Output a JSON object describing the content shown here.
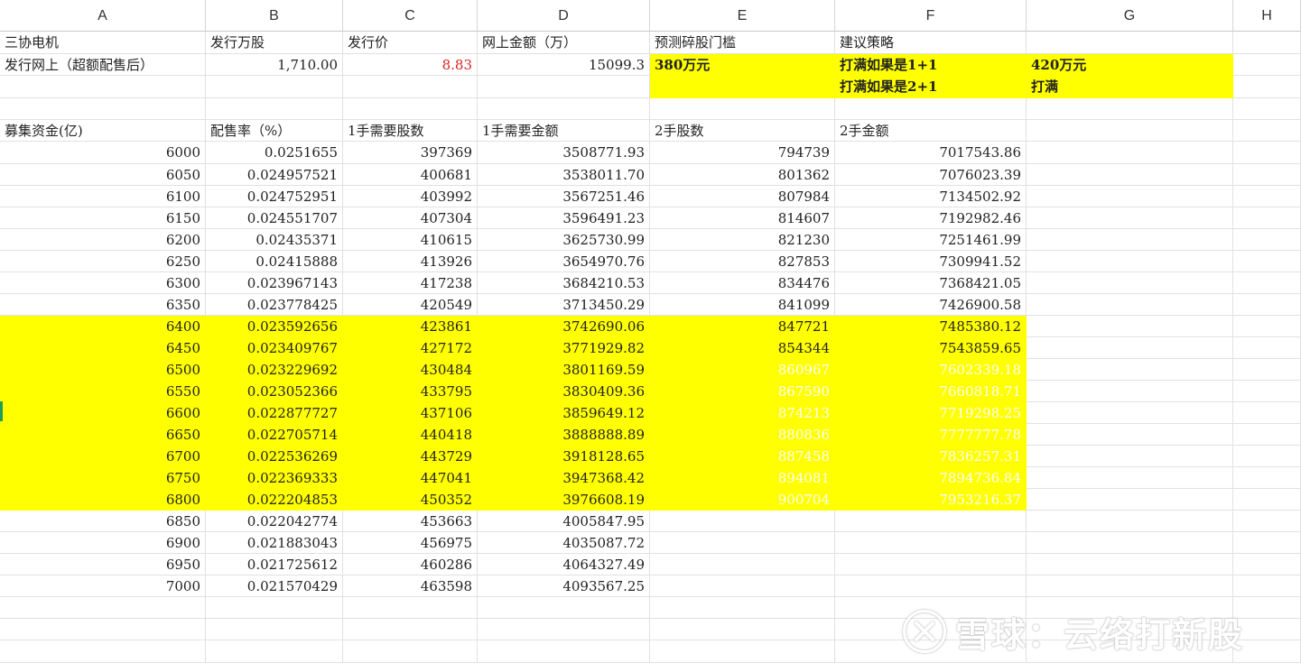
{
  "columns": [
    "A",
    "B",
    "C",
    "D",
    "E",
    "F",
    "G",
    "H"
  ],
  "rows": [
    {
      "cells": [
        {
          "t": "三协电机",
          "al": "l"
        },
        {
          "t": "发行万股",
          "al": "l"
        },
        {
          "t": "发行价",
          "al": "l"
        },
        {
          "t": "网上金额（万）",
          "al": "l"
        },
        {
          "t": "预测碎股门槛",
          "al": "l"
        },
        {
          "t": "建议策略",
          "al": "l"
        },
        {
          "t": ""
        },
        {
          "t": ""
        }
      ]
    },
    {
      "cells": [
        {
          "t": "发行网上（超额配售后）",
          "al": "l"
        },
        {
          "t": "1,710.00",
          "al": "r"
        },
        {
          "t": "8.83",
          "al": "r",
          "red": true
        },
        {
          "t": "15099.3",
          "al": "r"
        },
        {
          "t": "380万元",
          "al": "l",
          "y": true,
          "b": true
        },
        {
          "t": "打满如果是1+1",
          "al": "l",
          "y": true,
          "b": true
        },
        {
          "t": "420万元",
          "al": "l",
          "y": true,
          "b": true
        },
        {
          "t": ""
        }
      ]
    },
    {
      "cells": [
        {
          "t": ""
        },
        {
          "t": ""
        },
        {
          "t": ""
        },
        {
          "t": ""
        },
        {
          "t": "",
          "y": true
        },
        {
          "t": "打满如果是2+1",
          "al": "l",
          "y": true,
          "b": true
        },
        {
          "t": "打满",
          "al": "l",
          "y": true,
          "b": true
        },
        {
          "t": ""
        }
      ]
    },
    {
      "cells": [
        {
          "t": ""
        },
        {
          "t": ""
        },
        {
          "t": ""
        },
        {
          "t": ""
        },
        {
          "t": ""
        },
        {
          "t": ""
        },
        {
          "t": ""
        },
        {
          "t": ""
        }
      ]
    },
    {
      "cells": [
        {
          "t": "募集资金(亿)",
          "al": "l"
        },
        {
          "t": "配售率（%）",
          "al": "l"
        },
        {
          "t": "1手需要股数",
          "al": "l"
        },
        {
          "t": "1手需要金额",
          "al": "l"
        },
        {
          "t": "2手股数",
          "al": "l"
        },
        {
          "t": "2手金额",
          "al": "l"
        },
        {
          "t": ""
        },
        {
          "t": ""
        }
      ]
    },
    {
      "cells": [
        {
          "t": "6000",
          "al": "r"
        },
        {
          "t": "0.0251655",
          "al": "r"
        },
        {
          "t": "397369",
          "al": "r"
        },
        {
          "t": "3508771.93",
          "al": "r"
        },
        {
          "t": "794739",
          "al": "r"
        },
        {
          "t": "7017543.86",
          "al": "r"
        },
        {
          "t": ""
        },
        {
          "t": ""
        }
      ]
    },
    {
      "cells": [
        {
          "t": "6050",
          "al": "r"
        },
        {
          "t": "0.024957521",
          "al": "r"
        },
        {
          "t": "400681",
          "al": "r"
        },
        {
          "t": "3538011.70",
          "al": "r"
        },
        {
          "t": "801362",
          "al": "r"
        },
        {
          "t": "7076023.39",
          "al": "r"
        },
        {
          "t": ""
        },
        {
          "t": ""
        }
      ]
    },
    {
      "cells": [
        {
          "t": "6100",
          "al": "r"
        },
        {
          "t": "0.024752951",
          "al": "r"
        },
        {
          "t": "403992",
          "al": "r"
        },
        {
          "t": "3567251.46",
          "al": "r"
        },
        {
          "t": "807984",
          "al": "r"
        },
        {
          "t": "7134502.92",
          "al": "r"
        },
        {
          "t": ""
        },
        {
          "t": ""
        }
      ]
    },
    {
      "cells": [
        {
          "t": "6150",
          "al": "r"
        },
        {
          "t": "0.024551707",
          "al": "r"
        },
        {
          "t": "407304",
          "al": "r"
        },
        {
          "t": "3596491.23",
          "al": "r"
        },
        {
          "t": "814607",
          "al": "r"
        },
        {
          "t": "7192982.46",
          "al": "r"
        },
        {
          "t": ""
        },
        {
          "t": ""
        }
      ]
    },
    {
      "cells": [
        {
          "t": "6200",
          "al": "r"
        },
        {
          "t": "0.02435371",
          "al": "r"
        },
        {
          "t": "410615",
          "al": "r"
        },
        {
          "t": "3625730.99",
          "al": "r"
        },
        {
          "t": "821230",
          "al": "r"
        },
        {
          "t": "7251461.99",
          "al": "r"
        },
        {
          "t": ""
        },
        {
          "t": ""
        }
      ]
    },
    {
      "cells": [
        {
          "t": "6250",
          "al": "r"
        },
        {
          "t": "0.02415888",
          "al": "r"
        },
        {
          "t": "413926",
          "al": "r"
        },
        {
          "t": "3654970.76",
          "al": "r"
        },
        {
          "t": "827853",
          "al": "r"
        },
        {
          "t": "7309941.52",
          "al": "r"
        },
        {
          "t": ""
        },
        {
          "t": ""
        }
      ]
    },
    {
      "cells": [
        {
          "t": "6300",
          "al": "r"
        },
        {
          "t": "0.023967143",
          "al": "r"
        },
        {
          "t": "417238",
          "al": "r"
        },
        {
          "t": "3684210.53",
          "al": "r"
        },
        {
          "t": "834476",
          "al": "r"
        },
        {
          "t": "7368421.05",
          "al": "r"
        },
        {
          "t": ""
        },
        {
          "t": ""
        }
      ]
    },
    {
      "cells": [
        {
          "t": "6350",
          "al": "r"
        },
        {
          "t": "0.023778425",
          "al": "r"
        },
        {
          "t": "420549",
          "al": "r"
        },
        {
          "t": "3713450.29",
          "al": "r"
        },
        {
          "t": "841099",
          "al": "r"
        },
        {
          "t": "7426900.58",
          "al": "r"
        },
        {
          "t": ""
        },
        {
          "t": ""
        }
      ]
    },
    {
      "cells": [
        {
          "t": "6400",
          "al": "r",
          "y": true
        },
        {
          "t": "0.023592656",
          "al": "r",
          "y": true
        },
        {
          "t": "423861",
          "al": "r",
          "y": true
        },
        {
          "t": "3742690.06",
          "al": "r",
          "y": true
        },
        {
          "t": "847721",
          "al": "r",
          "y": true
        },
        {
          "t": "7485380.12",
          "al": "r",
          "y": true
        },
        {
          "t": ""
        },
        {
          "t": ""
        }
      ]
    },
    {
      "cells": [
        {
          "t": "6450",
          "al": "r",
          "y": true
        },
        {
          "t": "0.023409767",
          "al": "r",
          "y": true
        },
        {
          "t": "427172",
          "al": "r",
          "y": true
        },
        {
          "t": "3771929.82",
          "al": "r",
          "y": true
        },
        {
          "t": "854344",
          "al": "r",
          "y": true
        },
        {
          "t": "7543859.65",
          "al": "r",
          "y": true
        },
        {
          "t": ""
        },
        {
          "t": ""
        }
      ]
    },
    {
      "cells": [
        {
          "t": "6500",
          "al": "r",
          "y": true
        },
        {
          "t": "0.023229692",
          "al": "r",
          "y": true
        },
        {
          "t": "430484",
          "al": "r",
          "y": true
        },
        {
          "t": "3801169.59",
          "al": "r",
          "y": true
        },
        {
          "t": "860967",
          "al": "r",
          "y": true,
          "w": true
        },
        {
          "t": "7602339.18",
          "al": "r",
          "y": true,
          "w": true
        },
        {
          "t": ""
        },
        {
          "t": ""
        }
      ]
    },
    {
      "cells": [
        {
          "t": "6550",
          "al": "r",
          "y": true
        },
        {
          "t": "0.023052366",
          "al": "r",
          "y": true
        },
        {
          "t": "433795",
          "al": "r",
          "y": true
        },
        {
          "t": "3830409.36",
          "al": "r",
          "y": true
        },
        {
          "t": "867590",
          "al": "r",
          "y": true,
          "w": true
        },
        {
          "t": "7660818.71",
          "al": "r",
          "y": true,
          "w": true
        },
        {
          "t": ""
        },
        {
          "t": ""
        }
      ]
    },
    {
      "cells": [
        {
          "t": "6600",
          "al": "r",
          "y": true
        },
        {
          "t": "0.022877727",
          "al": "r",
          "y": true
        },
        {
          "t": "437106",
          "al": "r",
          "y": true
        },
        {
          "t": "3859649.12",
          "al": "r",
          "y": true
        },
        {
          "t": "874213",
          "al": "r",
          "y": true,
          "w": true
        },
        {
          "t": "7719298.25",
          "al": "r",
          "y": true,
          "w": true
        },
        {
          "t": ""
        },
        {
          "t": ""
        }
      ]
    },
    {
      "cells": [
        {
          "t": "6650",
          "al": "r",
          "y": true
        },
        {
          "t": "0.022705714",
          "al": "r",
          "y": true
        },
        {
          "t": "440418",
          "al": "r",
          "y": true
        },
        {
          "t": "3888888.89",
          "al": "r",
          "y": true
        },
        {
          "t": "880836",
          "al": "r",
          "y": true,
          "w": true
        },
        {
          "t": "7777777.78",
          "al": "r",
          "y": true,
          "w": true
        },
        {
          "t": ""
        },
        {
          "t": ""
        }
      ]
    },
    {
      "cells": [
        {
          "t": "6700",
          "al": "r",
          "y": true
        },
        {
          "t": "0.022536269",
          "al": "r",
          "y": true
        },
        {
          "t": "443729",
          "al": "r",
          "y": true
        },
        {
          "t": "3918128.65",
          "al": "r",
          "y": true
        },
        {
          "t": "887458",
          "al": "r",
          "y": true,
          "w": true
        },
        {
          "t": "7836257.31",
          "al": "r",
          "y": true,
          "w": true
        },
        {
          "t": ""
        },
        {
          "t": ""
        }
      ]
    },
    {
      "cells": [
        {
          "t": "6750",
          "al": "r",
          "y": true
        },
        {
          "t": "0.022369333",
          "al": "r",
          "y": true
        },
        {
          "t": "447041",
          "al": "r",
          "y": true
        },
        {
          "t": "3947368.42",
          "al": "r",
          "y": true
        },
        {
          "t": "894081",
          "al": "r",
          "y": true,
          "w": true
        },
        {
          "t": "7894736.84",
          "al": "r",
          "y": true,
          "w": true
        },
        {
          "t": ""
        },
        {
          "t": ""
        }
      ]
    },
    {
      "cells": [
        {
          "t": "6800",
          "al": "r",
          "y": true
        },
        {
          "t": "0.022204853",
          "al": "r",
          "y": true
        },
        {
          "t": "450352",
          "al": "r",
          "y": true
        },
        {
          "t": "3976608.19",
          "al": "r",
          "y": true
        },
        {
          "t": "900704",
          "al": "r",
          "y": true,
          "w": true
        },
        {
          "t": "7953216.37",
          "al": "r",
          "y": true,
          "w": true
        },
        {
          "t": ""
        },
        {
          "t": ""
        }
      ]
    },
    {
      "cells": [
        {
          "t": "6850",
          "al": "r"
        },
        {
          "t": "0.022042774",
          "al": "r"
        },
        {
          "t": "453663",
          "al": "r"
        },
        {
          "t": "4005847.95",
          "al": "r"
        },
        {
          "t": ""
        },
        {
          "t": ""
        },
        {
          "t": ""
        },
        {
          "t": ""
        }
      ]
    },
    {
      "cells": [
        {
          "t": "6900",
          "al": "r"
        },
        {
          "t": "0.021883043",
          "al": "r"
        },
        {
          "t": "456975",
          "al": "r"
        },
        {
          "t": "4035087.72",
          "al": "r"
        },
        {
          "t": ""
        },
        {
          "t": ""
        },
        {
          "t": ""
        },
        {
          "t": ""
        }
      ]
    },
    {
      "cells": [
        {
          "t": "6950",
          "al": "r"
        },
        {
          "t": "0.021725612",
          "al": "r"
        },
        {
          "t": "460286",
          "al": "r"
        },
        {
          "t": "4064327.49",
          "al": "r"
        },
        {
          "t": ""
        },
        {
          "t": ""
        },
        {
          "t": ""
        },
        {
          "t": ""
        }
      ]
    },
    {
      "cells": [
        {
          "t": "7000",
          "al": "r"
        },
        {
          "t": "0.021570429",
          "al": "r"
        },
        {
          "t": "463598",
          "al": "r"
        },
        {
          "t": "4093567.25",
          "al": "r"
        },
        {
          "t": ""
        },
        {
          "t": ""
        },
        {
          "t": ""
        },
        {
          "t": ""
        }
      ]
    },
    {
      "cells": [
        {
          "t": ""
        },
        {
          "t": ""
        },
        {
          "t": ""
        },
        {
          "t": ""
        },
        {
          "t": ""
        },
        {
          "t": ""
        },
        {
          "t": ""
        },
        {
          "t": ""
        }
      ]
    },
    {
      "cells": [
        {
          "t": ""
        },
        {
          "t": ""
        },
        {
          "t": ""
        },
        {
          "t": ""
        },
        {
          "t": ""
        },
        {
          "t": ""
        },
        {
          "t": ""
        },
        {
          "t": ""
        }
      ]
    },
    {
      "cells": [
        {
          "t": ""
        },
        {
          "t": ""
        },
        {
          "t": ""
        },
        {
          "t": ""
        },
        {
          "t": ""
        },
        {
          "t": ""
        },
        {
          "t": ""
        },
        {
          "t": ""
        }
      ]
    }
  ],
  "watermark": {
    "text": "雪球：云络打新股",
    "icon": "xueqiu-logo-icon"
  },
  "colors": {
    "highlight": "#ffff00",
    "red": "#e02020",
    "white": "#ffffff"
  }
}
